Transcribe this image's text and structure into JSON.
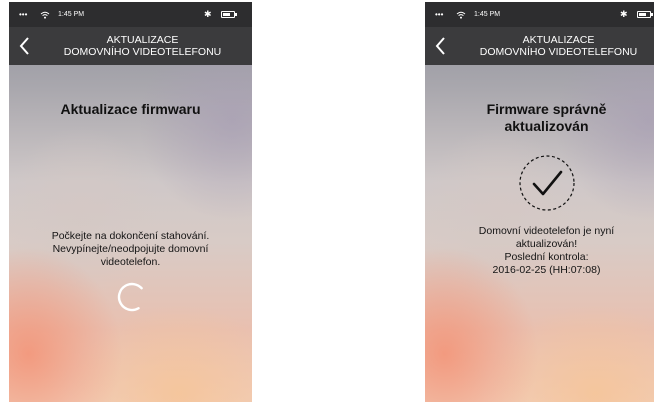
{
  "left_screen": {
    "status": {
      "time": "1:45 PM",
      "signal_icon": "signal-dots-icon",
      "wifi_icon": "wifi-icon",
      "bluetooth_icon": "bluetooth-icon",
      "battery_icon": "battery-icon"
    },
    "nav": {
      "title": "AKTUALIZACE\nDOMOVNÍHO VIDEOTELEFONU",
      "back_icon": "chevron-left-icon"
    },
    "heading": "Aktualizace firmwaru",
    "message": "Počkejte na dokončení stahování.\nNevypínejte/neodpojujte domovní\nvideotelefon.",
    "progress_icon": "loading-spinner-icon"
  },
  "right_screen": {
    "status": {
      "time": "1:45 PM",
      "signal_icon": "signal-dots-icon",
      "wifi_icon": "wifi-icon",
      "bluetooth_icon": "bluetooth-icon",
      "battery_icon": "battery-icon"
    },
    "nav": {
      "title": "AKTUALIZACE\nDOMOVNÍHO VIDEOTELEFONU",
      "back_icon": "chevron-left-icon"
    },
    "heading": "Firmware správně\naktualizován",
    "success_icon": "checkmark-icon",
    "message": "Domovní videotelefon je nyní\naktualizován!\nPoslední kontrola:\n2016-02-25 (HH:07:08)"
  },
  "colors": {
    "status_bar": "#2d2d2f",
    "nav_bar": "#3b3b3d",
    "text": "#111111",
    "icon_stroke": "#111111",
    "spinner": "#ffffff"
  }
}
